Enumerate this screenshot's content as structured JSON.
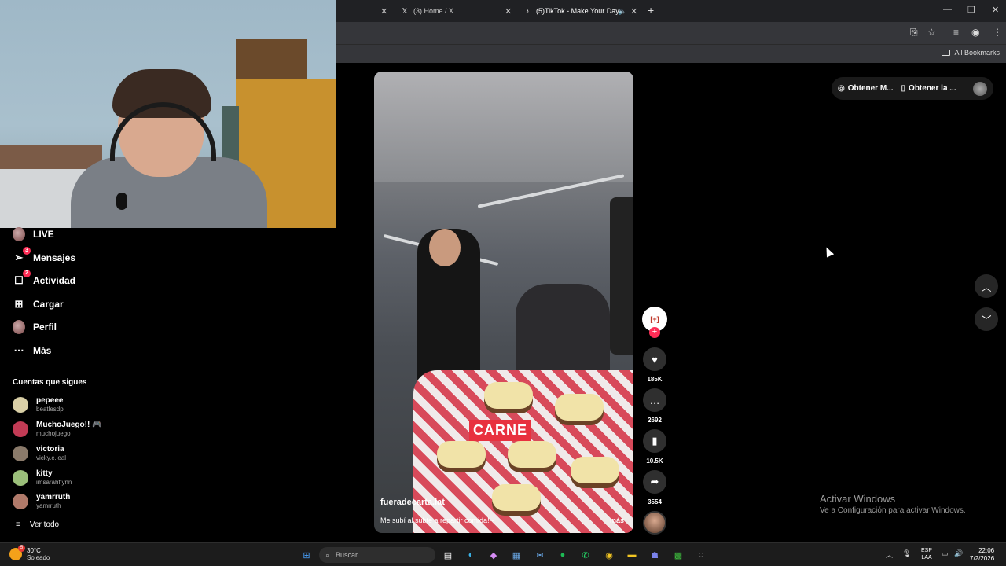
{
  "browser": {
    "tabs": [
      {
        "label": "",
        "active": false
      },
      {
        "label": "(3) Home / X",
        "active": false
      },
      {
        "label": "(5)TikTok - Make Your Day",
        "active": true
      }
    ],
    "bookmarks_label": "All Bookmarks"
  },
  "sidebar": {
    "items": [
      {
        "label": "LIVE",
        "icon": "live-avatar-icon"
      },
      {
        "label": "Mensajes",
        "icon": "send-icon",
        "badge": "3"
      },
      {
        "label": "Actividad",
        "icon": "activity-icon",
        "badge": "2"
      },
      {
        "label": "Cargar",
        "icon": "upload-icon"
      },
      {
        "label": "Perfil",
        "icon": "profile-avatar-icon"
      },
      {
        "label": "Más",
        "icon": "more-icon"
      }
    ],
    "following_title": "Cuentas que sigues",
    "following": [
      {
        "name": "pepeee",
        "handle": "beatlesdp"
      },
      {
        "name": "MuchoJuego!! 🎮",
        "handle": "muchojuego"
      },
      {
        "name": "victoria",
        "handle": "vicky.c.leal"
      },
      {
        "name": "kitty",
        "handle": "imsarahflynn"
      },
      {
        "name": "yamrruth",
        "handle": "yamrruth"
      }
    ],
    "see_all": "Ver todo"
  },
  "video": {
    "overlay_text": "CARNE",
    "username": "fueradecarta.lat",
    "caption": "Me subí al subte a repartir comida!--",
    "more": "más",
    "creator_avatar_text": "[+]"
  },
  "actions": {
    "likes": "185K",
    "comments": "2692",
    "saves": "10.5K",
    "shares": "3554"
  },
  "header_pill": {
    "item1": "Obtener M...",
    "item2": "Obtener la ..."
  },
  "watermark": {
    "title": "Activar Windows",
    "subtitle": "Ve a Configuración para activar Windows."
  },
  "taskbar": {
    "temp": "30°C",
    "condition": "Soleado",
    "weather_badge": "5",
    "search_placeholder": "Buscar",
    "lang_line1": "ESP",
    "lang_line2": "LAA",
    "time": "22:06",
    "date": "7/2/2026"
  }
}
